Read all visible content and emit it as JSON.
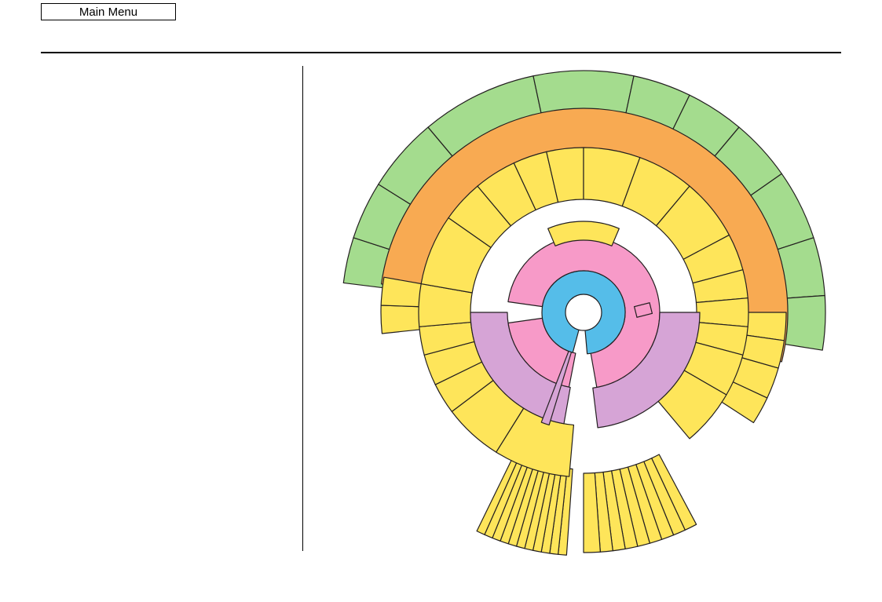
{
  "header": {
    "main_menu_label": "Main Menu"
  },
  "colors": {
    "center": "#ffffff",
    "blue": "#55bde9",
    "pink": "#f79ac8",
    "purple": "#d6a4d6",
    "yellow": "#fee55a",
    "orange": "#f8aa52",
    "green": "#a4dc8e",
    "stroke": "#231f20"
  },
  "diagram": {
    "rings": [
      {
        "name": "ring-yellow-mid",
        "color": "yellow",
        "segments": [
          {
            "start": 95,
            "end": 122
          },
          {
            "start": 122,
            "end": 143
          },
          {
            "start": 143,
            "end": 154
          },
          {
            "start": 154,
            "end": 165
          },
          {
            "start": 165,
            "end": 175
          },
          {
            "start": 175,
            "end": 190
          },
          {
            "start": 190,
            "end": 215
          },
          {
            "start": 215,
            "end": 230
          },
          {
            "start": 230,
            "end": 245
          },
          {
            "start": 245,
            "end": 257
          },
          {
            "start": 257,
            "end": 270
          },
          {
            "start": 270,
            "end": 290
          },
          {
            "start": 290,
            "end": 310
          },
          {
            "start": 310,
            "end": 332
          },
          {
            "start": 332,
            "end": 345
          },
          {
            "start": 345,
            "end": 355
          },
          {
            "start": 355,
            "end": 365
          },
          {
            "start": 365,
            "end": 375
          },
          {
            "start": 375,
            "end": 390
          },
          {
            "start": 390,
            "end": 410
          }
        ]
      },
      {
        "name": "ring-yellow-outer",
        "color": "yellow",
        "segments": [
          {
            "start": 174,
            "end": 182
          },
          {
            "start": 182,
            "end": 190
          },
          {
            "start": 360,
            "end": 368
          },
          {
            "start": 368,
            "end": 376
          },
          {
            "start": 376,
            "end": 385
          },
          {
            "start": 385,
            "end": 393
          }
        ]
      },
      {
        "name": "ring-orange",
        "color": "orange",
        "segments": [
          {
            "start": 188,
            "end": 374
          }
        ]
      },
      {
        "name": "ring-green",
        "color": "green",
        "segments": [
          {
            "start": 187,
            "end": 198
          },
          {
            "start": 198,
            "end": 212
          },
          {
            "start": 212,
            "end": 230
          },
          {
            "start": 230,
            "end": 258
          },
          {
            "start": 258,
            "end": 282
          },
          {
            "start": 282,
            "end": 296
          },
          {
            "start": 296,
            "end": 310
          },
          {
            "start": 310,
            "end": 325
          },
          {
            "start": 325,
            "end": 342
          },
          {
            "start": 342,
            "end": 356
          },
          {
            "start": 356,
            "end": 369
          }
        ]
      },
      {
        "name": "ring-yellow-left-fan",
        "color": "yellow",
        "segments": [
          {
            "start": 94,
            "end": 96
          },
          {
            "start": 96,
            "end": 98
          },
          {
            "start": 98,
            "end": 100
          },
          {
            "start": 100,
            "end": 102
          },
          {
            "start": 102,
            "end": 104
          },
          {
            "start": 104,
            "end": 106
          },
          {
            "start": 106,
            "end": 108
          },
          {
            "start": 108,
            "end": 110
          },
          {
            "start": 110,
            "end": 112
          },
          {
            "start": 112,
            "end": 114
          },
          {
            "start": 114,
            "end": 116
          }
        ]
      },
      {
        "name": "ring-yellow-right-fan",
        "color": "yellow",
        "segments": [
          {
            "start": 422,
            "end": 425
          },
          {
            "start": 425,
            "end": 428
          },
          {
            "start": 428,
            "end": 431
          },
          {
            "start": 431,
            "end": 434
          },
          {
            "start": 434,
            "end": 437
          },
          {
            "start": 437,
            "end": 440
          },
          {
            "start": 440,
            "end": 443
          },
          {
            "start": 443,
            "end": 446
          },
          {
            "start": 446,
            "end": 450
          }
        ]
      }
    ]
  }
}
